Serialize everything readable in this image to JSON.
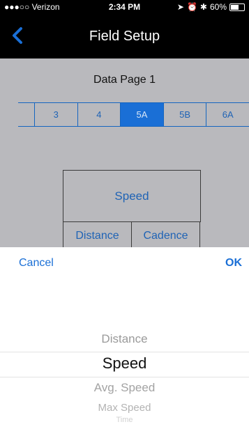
{
  "status": {
    "carrier": "●●●○○ Verizon",
    "time": "2:34 PM",
    "battery": "60%"
  },
  "nav": {
    "title": "Field Setup"
  },
  "page": {
    "title": "Data Page 1"
  },
  "segments": [
    "3",
    "4",
    "5A",
    "5B",
    "6A"
  ],
  "selected_segment": "5A",
  "fields": {
    "main": "Speed",
    "left": "Distance",
    "right": "Cadence"
  },
  "toolbar": {
    "cancel_label": "Cancel",
    "ok_label": "OK"
  },
  "picker": {
    "items": [
      "Distance",
      "Speed",
      "Avg. Speed",
      "Max Speed",
      "Time"
    ],
    "selected": "Speed"
  },
  "colors": {
    "accent": "#1a6fd6",
    "background": "#b9b9bd",
    "nav_bg": "#000000"
  }
}
